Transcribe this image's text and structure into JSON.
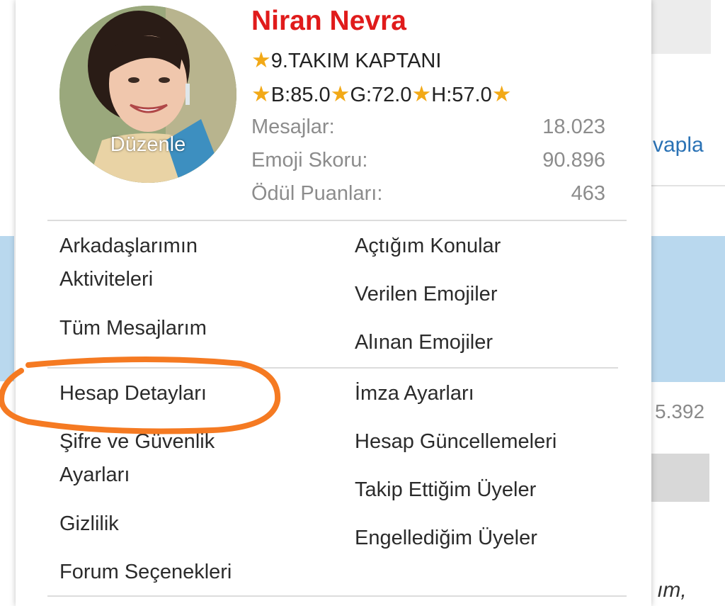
{
  "background": {
    "reply_link": "vapla",
    "partial_number": "5.392",
    "partial_text": "ım,"
  },
  "profile": {
    "name": "Niran Nevra",
    "edit_label": "Düzenle",
    "rank": "9.TAKIM KAPTANI",
    "stats_line": {
      "b": "B:85.0",
      "g": "G:72.0",
      "h": "H:57.0"
    },
    "stats": [
      {
        "label": "Mesajlar:",
        "value": "18.023"
      },
      {
        "label": "Emoji Skoru:",
        "value": "90.896"
      },
      {
        "label": "Ödül Puanları:",
        "value": "463"
      }
    ]
  },
  "menu": {
    "left_top": [
      "Arkadaşlarımın Aktiviteleri",
      "Tüm Mesajlarım"
    ],
    "right_top": [
      "Açtığım Konular",
      "Verilen Emojiler",
      "Alınan Emojiler"
    ],
    "left_bottom": [
      "Hesap Detayları",
      "Şifre ve Güvenlik Ayarları",
      "Gizlilik",
      "Forum Seçenekleri"
    ],
    "right_bottom": [
      "İmza Ayarları",
      "Hesap Güncellemeleri",
      "Takip Ettiğim Üyeler",
      "Engellediğim Üyeler"
    ]
  },
  "colors": {
    "name": "#e01b1b",
    "star": "#f2a917",
    "annotation": "#f57a22"
  }
}
